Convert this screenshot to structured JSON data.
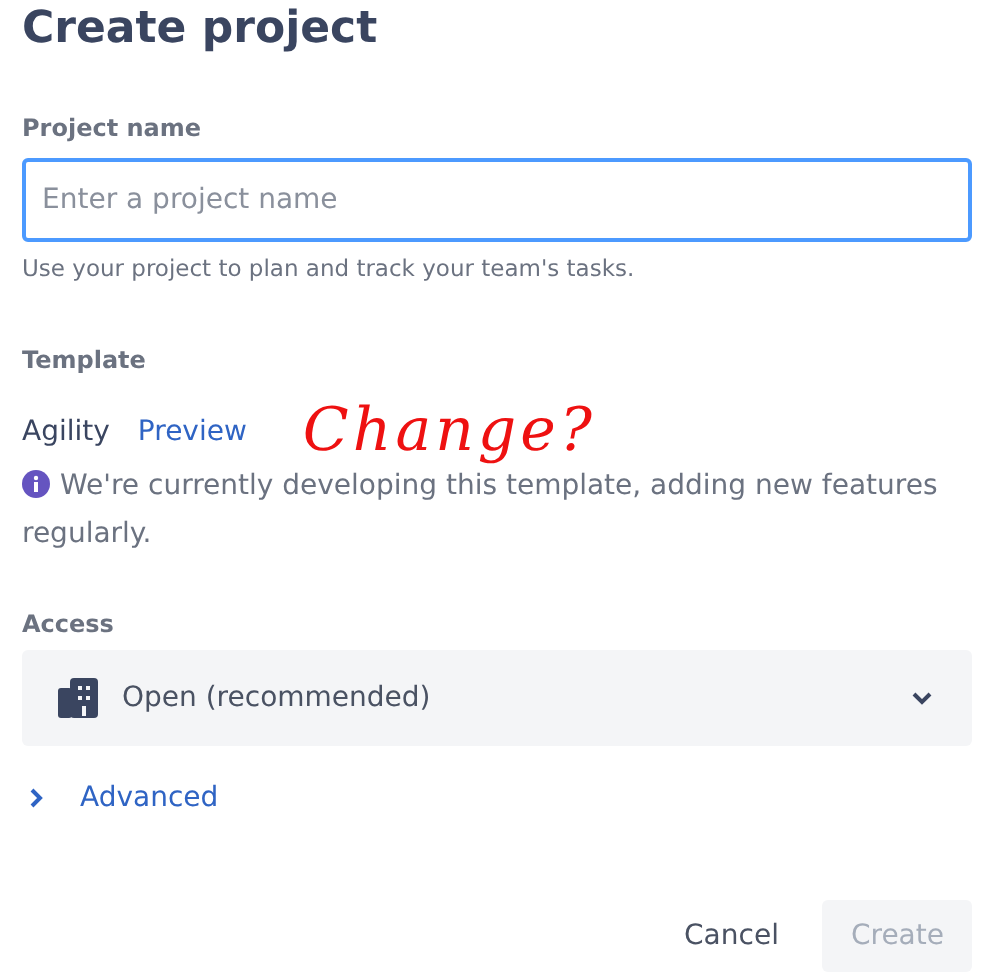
{
  "title": "Create project",
  "project_name": {
    "label": "Project name",
    "placeholder": "Enter a project name",
    "focused": true,
    "helper": "Use your project to plan and track your team's tasks."
  },
  "template": {
    "label": "Template",
    "name": "Agility",
    "link": "Preview",
    "info": "We're currently developing this template, adding new features regularly."
  },
  "annotation": {
    "text": "Change?",
    "color": "#ee1111"
  },
  "access": {
    "label": "Access",
    "value": "Open (recommended)"
  },
  "advanced": {
    "label": "Advanced",
    "expanded": false
  },
  "buttons": [
    {
      "label": "Cancel",
      "kind": "subtle",
      "disabled": false
    },
    {
      "label": "Create",
      "kind": "primary",
      "disabled": true
    }
  ]
}
